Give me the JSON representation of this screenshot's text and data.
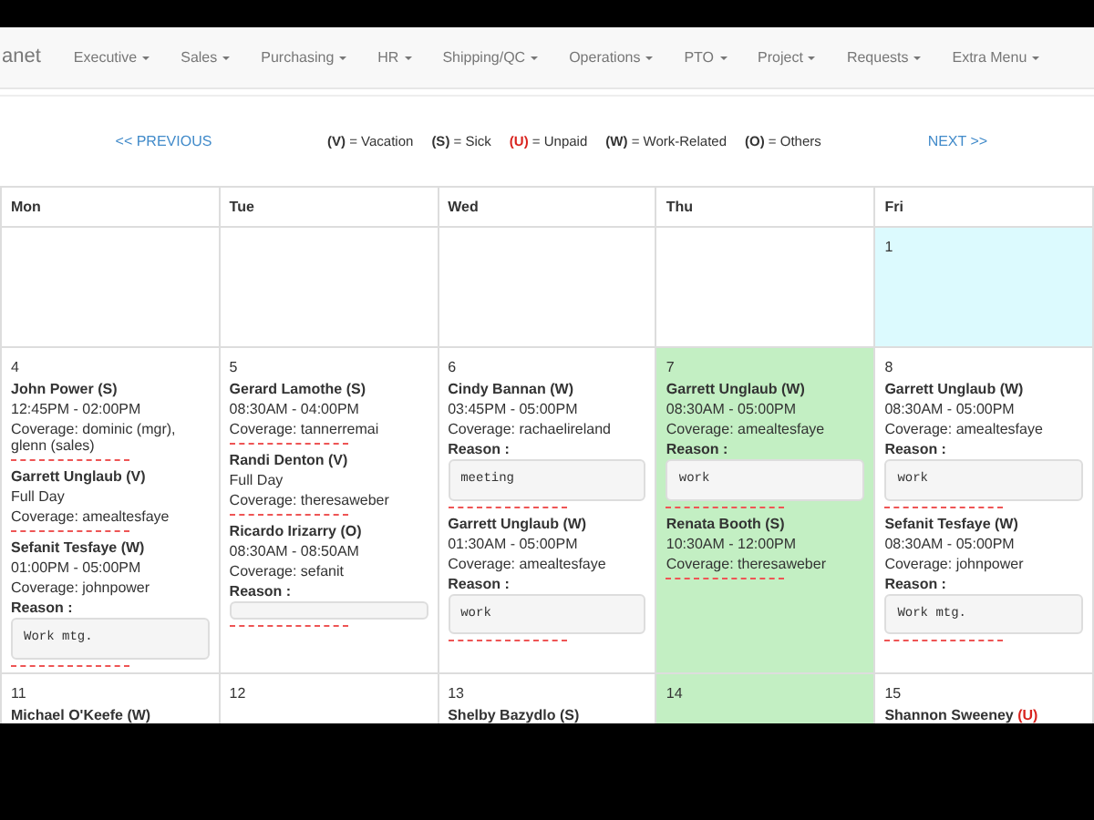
{
  "nav": {
    "brand": "anet",
    "items": [
      "Executive",
      "Sales",
      "Purchasing",
      "HR",
      "Shipping/QC",
      "Operations",
      "PTO",
      "Project",
      "Requests",
      "Extra Menu"
    ]
  },
  "pager": {
    "previous": "<< PREVIOUS",
    "next": "NEXT >>"
  },
  "legend": [
    {
      "code": "(V)",
      "label": "= Vacation",
      "kind": "normal"
    },
    {
      "code": "(S)",
      "label": "= Sick",
      "kind": "normal"
    },
    {
      "code": "(U)",
      "label": "= Unpaid",
      "kind": "unpaid"
    },
    {
      "code": "(W)",
      "label": "= Work-Related",
      "kind": "normal"
    },
    {
      "code": "(O)",
      "label": "= Others",
      "kind": "normal"
    }
  ],
  "calendar": {
    "columns": [
      "Mon",
      "Tue",
      "Wed",
      "Thu",
      "Fri"
    ],
    "weeks": [
      {
        "days": [
          {
            "kind": "blank"
          },
          {
            "kind": "blank"
          },
          {
            "kind": "blank"
          },
          {
            "kind": "blank"
          },
          {
            "kind": "day",
            "day": "1",
            "color": "#dcfafe"
          }
        ]
      },
      {
        "days": [
          {
            "kind": "day",
            "day": "4",
            "entries": [
              {
                "name": "John Power",
                "code": "(S)",
                "kind": "normal",
                "time": "12:45PM - 02:00PM",
                "coverage": "Coverage: dominic (mgr), glenn (sales)"
              },
              {
                "name": "Garrett Unglaub",
                "code": "(V)",
                "kind": "normal",
                "time": "Full Day",
                "coverage": "Coverage: amealtesfaye"
              },
              {
                "name": "Sefanit Tesfaye",
                "code": "(W)",
                "kind": "normal",
                "time": "01:00PM - 05:00PM",
                "coverage": "Coverage: johnpower",
                "reason_label": "Reason :",
                "reason": "Work mtg."
              }
            ]
          },
          {
            "kind": "day",
            "day": "5",
            "entries": [
              {
                "name": "Gerard Lamothe",
                "code": "(S)",
                "kind": "normal",
                "time": "08:30AM - 04:00PM",
                "coverage": "Coverage: tannerremai"
              },
              {
                "name": "Randi Denton",
                "code": "(V)",
                "kind": "normal",
                "time": "Full Day",
                "coverage": "Coverage: theresaweber"
              },
              {
                "name": "Ricardo Irizarry",
                "code": "(O)",
                "kind": "normal",
                "time": "08:30AM - 08:50AM",
                "coverage": "Coverage: sefanit",
                "reason_label": "Reason :",
                "reason_box": true
              }
            ]
          },
          {
            "kind": "day",
            "day": "6",
            "entries": [
              {
                "name": "Cindy Bannan",
                "code": "(W)",
                "kind": "normal",
                "time": "03:45PM - 05:00PM",
                "coverage": "Coverage: rachaelireland",
                "reason_label": "Reason :",
                "reason": "meeting"
              },
              {
                "name": "Garrett Unglaub",
                "code": "(W)",
                "kind": "normal",
                "time": "01:30AM - 05:00PM",
                "coverage": "Coverage: amealtesfaye",
                "reason_label": "Reason :",
                "reason": "work"
              }
            ]
          },
          {
            "kind": "day",
            "day": "7",
            "color": "#c3efc3",
            "entries": [
              {
                "name": "Garrett Unglaub",
                "code": "(W)",
                "kind": "normal",
                "time": "08:30AM - 05:00PM",
                "coverage": "Coverage: amealtesfaye",
                "reason_label": "Reason :",
                "reason": "work"
              },
              {
                "name": "Renata Booth",
                "code": "(S)",
                "kind": "normal",
                "time": "10:30AM - 12:00PM",
                "coverage": "Coverage: theresaweber"
              }
            ]
          },
          {
            "kind": "day",
            "day": "8",
            "entries": [
              {
                "name": "Garrett Unglaub",
                "code": "(W)",
                "kind": "normal",
                "time": "08:30AM - 05:00PM",
                "coverage": "Coverage: amealtesfaye",
                "reason_label": "Reason :",
                "reason": "work"
              },
              {
                "name": "Sefanit Tesfaye",
                "code": "(W)",
                "kind": "normal",
                "time": "08:30AM - 05:00PM",
                "coverage": "Coverage: johnpower",
                "reason_label": "Reason :",
                "reason": "Work mtg."
              }
            ]
          }
        ]
      },
      {
        "days": [
          {
            "kind": "day",
            "day": "11",
            "entries": [
              {
                "name": "Michael O'Keefe",
                "code": "(W)",
                "kind": "normal"
              }
            ]
          },
          {
            "kind": "day",
            "day": "12"
          },
          {
            "kind": "day",
            "day": "13",
            "entries": [
              {
                "name": "Shelby Bazydlo",
                "code": "(S)",
                "kind": "normal"
              }
            ]
          },
          {
            "kind": "day",
            "day": "14",
            "color": "#c3efc3"
          },
          {
            "kind": "day",
            "day": "15",
            "entries": [
              {
                "name": "Shannon Sweeney",
                "code": "(U)",
                "kind": "unpaid"
              }
            ]
          }
        ]
      }
    ]
  }
}
